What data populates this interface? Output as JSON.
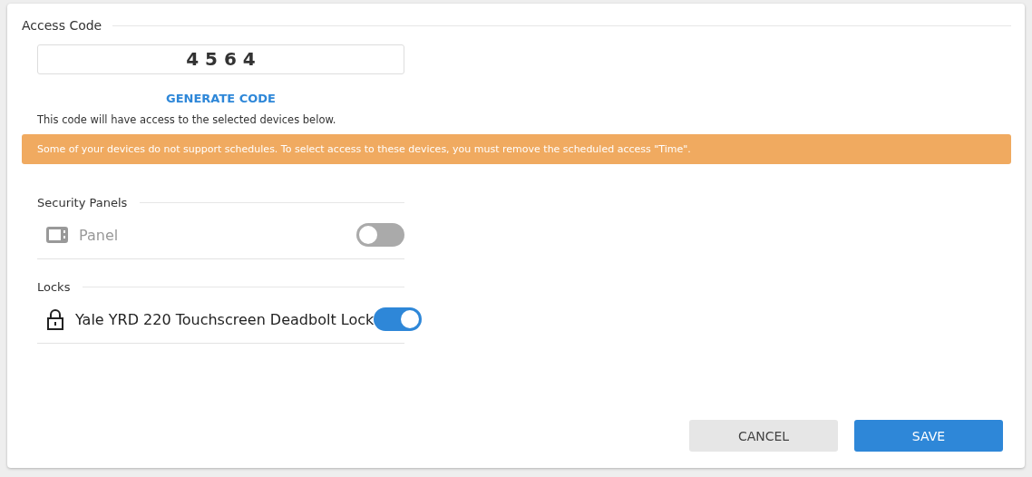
{
  "access_code": {
    "title": "Access Code",
    "code": "4 5 6 4",
    "generate_label": "GENERATE CODE",
    "note": "This code will have access to the selected devices below."
  },
  "warning": "Some of your devices do not support schedules. To select access to these devices, you must remove the scheduled access \"Time\".",
  "sections": [
    {
      "title": "Security Panels",
      "devices": [
        {
          "kind": "panel",
          "name": "Panel",
          "disabled": true,
          "on": false
        }
      ]
    },
    {
      "title": "Locks",
      "devices": [
        {
          "kind": "lock",
          "name": "Yale YRD 220 Touchscreen Deadbolt Lock",
          "disabled": false,
          "on": true
        }
      ]
    }
  ],
  "buttons": [
    {
      "kind": "secondary",
      "label": "CANCEL"
    },
    {
      "kind": "primary",
      "label": "SAVE"
    }
  ]
}
